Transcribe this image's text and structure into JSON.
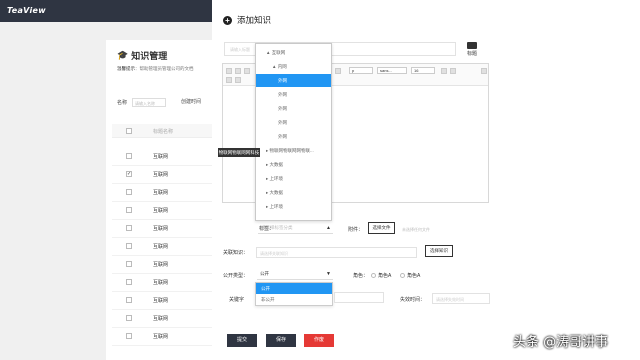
{
  "app": {
    "logo": "TeaView"
  },
  "background": {
    "title": "知识管理",
    "hint_label": "温馨提示",
    "hint_text": "：帮助管理员管理公司的文档",
    "filter_name_label": "名称",
    "filter_name_placeholder": "请输入名称",
    "filter_time_label": "创建时间",
    "table_header": "标题名称",
    "rows": [
      {
        "label": "互联网",
        "checked": ""
      },
      {
        "label": "互联网",
        "checked": "✓"
      },
      {
        "label": "互联网",
        "checked": ""
      },
      {
        "label": "互联网",
        "checked": ""
      },
      {
        "label": "互联网",
        "checked": ""
      },
      {
        "label": "互联网",
        "checked": ""
      },
      {
        "label": "互联网",
        "checked": ""
      },
      {
        "label": "互联网",
        "checked": ""
      },
      {
        "label": "互联网",
        "checked": ""
      },
      {
        "label": "互联网",
        "checked": ""
      },
      {
        "label": "互联网",
        "checked": ""
      }
    ]
  },
  "drawer": {
    "title": "添加知识",
    "title_placeholder": "请输入标题",
    "tag_button": "标题",
    "editor": {
      "font_select": "p",
      "family_select": "sans...",
      "size_select": "16"
    },
    "tree": [
      {
        "label": "▲ 互联网"
      },
      {
        "label": "▲ 内网"
      },
      {
        "label": "外网",
        "selected": true
      },
      {
        "label": "外网"
      },
      {
        "label": "外网"
      },
      {
        "label": "外网"
      },
      {
        "label": "外网"
      },
      {
        "label": "▸ 物联网物联网网物联..."
      },
      {
        "label": "▸ 大数据"
      },
      {
        "label": "▸ 上环境"
      },
      {
        "label": "▸ 大数据"
      },
      {
        "label": "▸ 上环境"
      }
    ],
    "tooltip": "物联网物联网网科技",
    "category_label": "标签：",
    "category_placeholder": "请选择标签分类",
    "attachment_label": "附件：",
    "upload_button": "选择文件",
    "upload_hint": "未选择任何文件",
    "related_label": "关联知识：",
    "related_placeholder": "请选择关联知识",
    "related_button": "选择知识",
    "visibility_label": "公开类型：",
    "visibility_value": "公开",
    "role_label": "角色：",
    "role_a": "角色A",
    "role_b": "角色A",
    "visibility_options": [
      "公开",
      "非公开"
    ],
    "keywords_label": "关键字",
    "expire_label": "失效时间：",
    "expire_placeholder": "请选择失效时间",
    "actions": {
      "submit": "提交",
      "save": "保存",
      "void": "作废"
    }
  },
  "colors": {
    "topbar": "#2f3542",
    "primary": "#2196f3",
    "dark_button": "#2f3542",
    "danger": "#e53935"
  },
  "watermark": "头条 @涛哥讲事"
}
